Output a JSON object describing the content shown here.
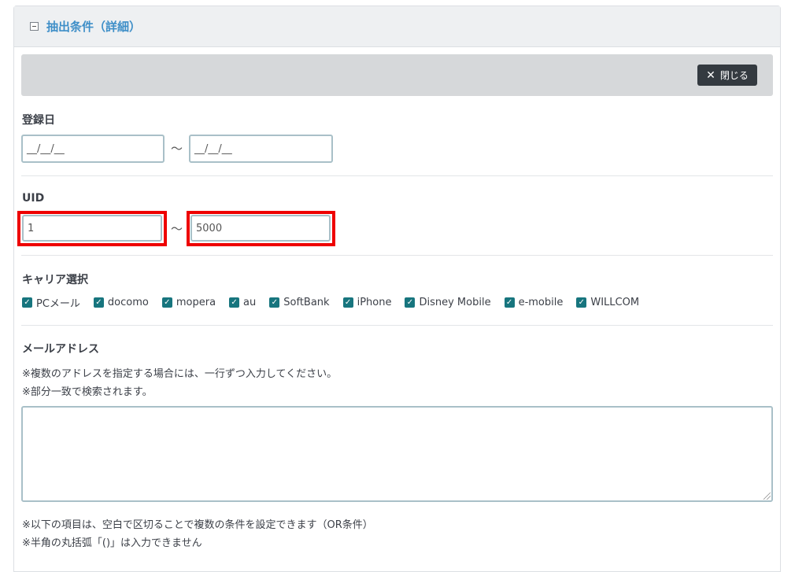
{
  "panel": {
    "title": "抽出条件（詳細）",
    "close_label": "閉じる"
  },
  "registration_date": {
    "label": "登録日",
    "from_placeholder": "__/__/__",
    "separator": "〜",
    "to_placeholder": "__/__/__"
  },
  "uid": {
    "label": "UID",
    "from_value": "1",
    "separator": "〜",
    "to_value": "5000"
  },
  "carrier": {
    "label": "キャリア選択",
    "options": [
      {
        "label": "PCメール",
        "checked": true
      },
      {
        "label": "docomo",
        "checked": true
      },
      {
        "label": "mopera",
        "checked": true
      },
      {
        "label": "au",
        "checked": true
      },
      {
        "label": "SoftBank",
        "checked": true
      },
      {
        "label": "iPhone",
        "checked": true
      },
      {
        "label": "Disney Mobile",
        "checked": true
      },
      {
        "label": "e-mobile",
        "checked": true
      },
      {
        "label": "WILLCOM",
        "checked": true
      }
    ]
  },
  "mail_address": {
    "label": "メールアドレス",
    "note1": "※複数のアドレスを指定する場合には、一行ずつ入力してください。",
    "note2": "※部分一致で検索されます。",
    "value": ""
  },
  "footer_notes": {
    "note1": "※以下の項目は、空白で区切ることで複数の条件を設定できます（OR条件）",
    "note2": "※半角の丸括弧「()」は入力できません"
  },
  "colors": {
    "accent_title": "#3f8fc8",
    "checkbox": "#17757e",
    "highlight": "#ee0000"
  }
}
